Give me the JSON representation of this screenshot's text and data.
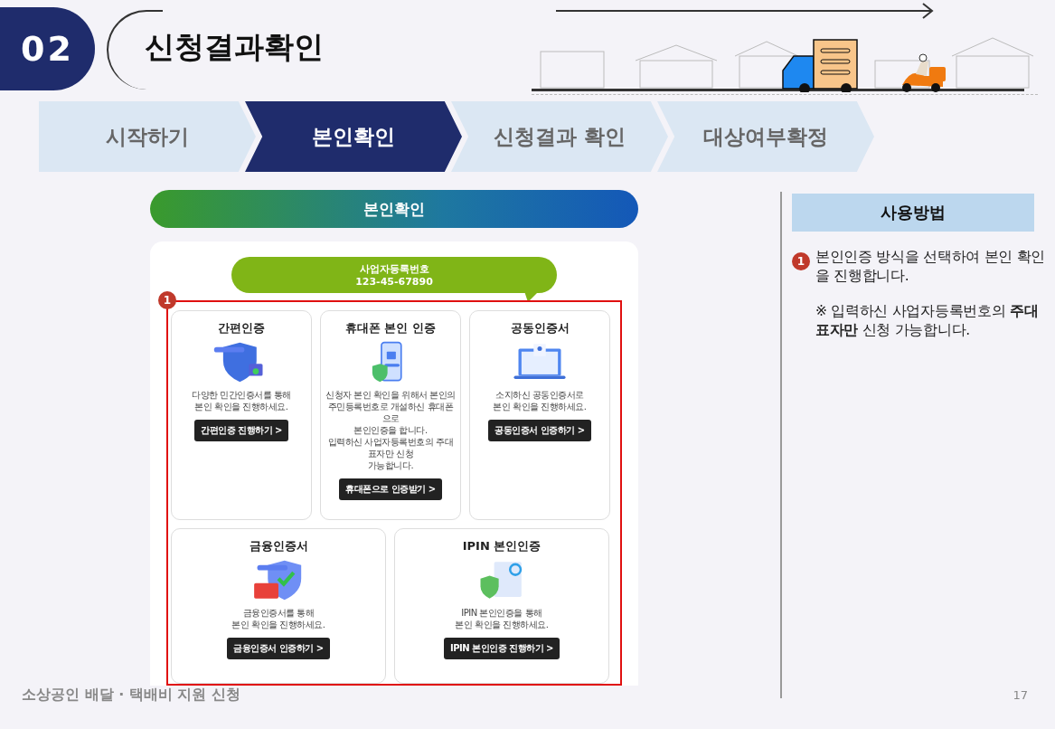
{
  "section": {
    "number": "02",
    "title": "신청결과확인"
  },
  "steps": [
    {
      "label": "시작하기",
      "selected": false
    },
    {
      "label": "본인확인",
      "selected": true
    },
    {
      "label": "신청결과 확인",
      "selected": false
    },
    {
      "label": "대상여부확정",
      "selected": false
    }
  ],
  "panel": {
    "title": "본인확인",
    "bubble": {
      "label": "사업자등록번호",
      "value": "123-45-67890"
    },
    "marker": "1",
    "methods": [
      {
        "title": "간편인증",
        "lines": [
          "다양한 민간인증서를 통해",
          "본인 확인을 진행하세요."
        ],
        "button": "간편인증 진행하기 >"
      },
      {
        "title": "휴대폰 본인 인증",
        "lines": [
          "신청자 본인 확인을 위해서 본인의",
          "주민등록번호로 개설하신 휴대폰으로",
          "본인인증을 합니다.",
          "입력하신 사업자등록번호의 주대표자만 신청",
          "가능합니다."
        ],
        "button": "휴대폰으로 인증받기 >"
      },
      {
        "title": "공동인증서",
        "lines": [
          "소지하신 공동인증서로",
          "본인 확인을 진행하세요."
        ],
        "button": "공동인증서 인증하기 >"
      },
      {
        "title": "금융인증서",
        "lines": [
          "금융인증서를 통해",
          "본인 확인을 진행하세요."
        ],
        "button": "금융인증서 인증하기 >"
      },
      {
        "title": "IPIN 본인인증",
        "lines": [
          "IPIN 본인인증을 통해",
          "본인 확인을 진행하세요."
        ],
        "button": "IPIN 본인인증 진행하기 >"
      }
    ]
  },
  "usage": {
    "title": "사용방법",
    "steps": [
      {
        "number": "1",
        "text": "본인인증 방식을 선택하여 본인 확인을 진행합니다.",
        "note": "※ 입력하신 사업자등록번호의 **주대표자만** 신청 가능합니다."
      }
    ]
  },
  "footer": {
    "text": "소상공인 배달 · 택배비 지원 신청",
    "page": "17"
  }
}
